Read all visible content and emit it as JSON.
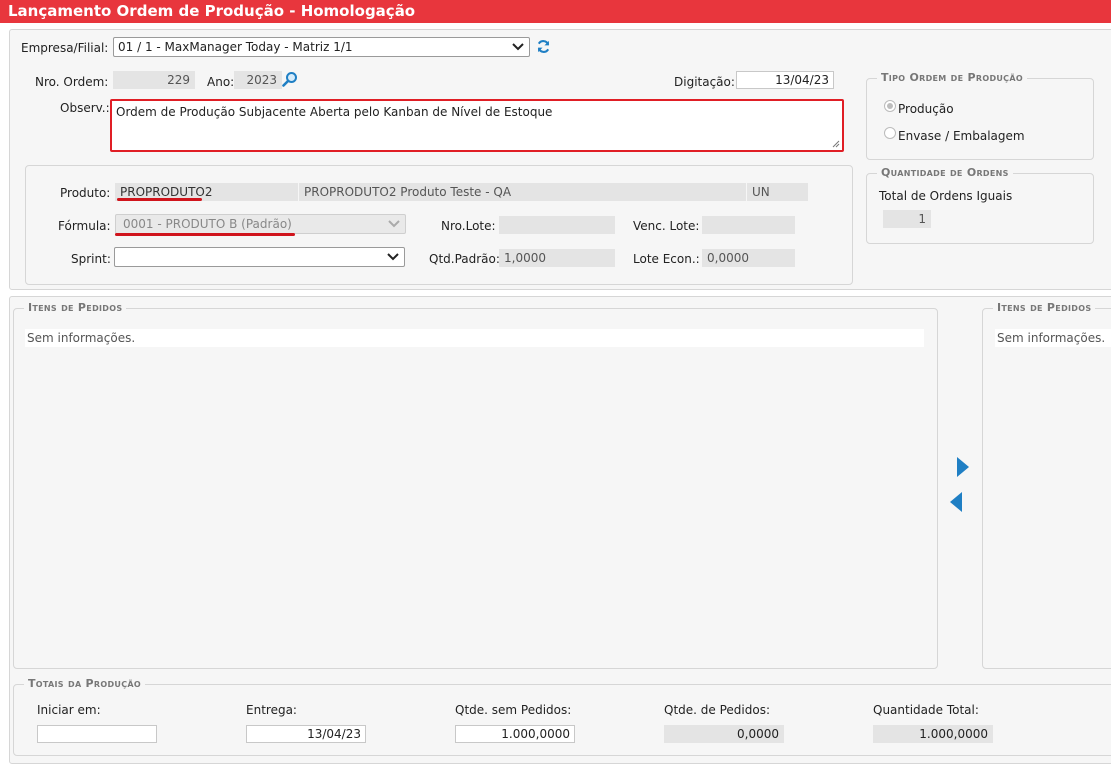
{
  "title": "Lançamento Ordem de Produção  - Homologação",
  "header": {
    "empresa_label": "Empresa/Filial:",
    "empresa_value": "01 / 1 - MaxManager Today - Matriz 1/1",
    "nro_ordem_label": "Nro. Ordem:",
    "nro_ordem_value": "229",
    "ano_label": "Ano:",
    "ano_value": "2023",
    "digitacao_label": "Digitação:",
    "digitacao_value": "13/04/23",
    "observ_label": "Observ.:",
    "observ_value": "Ordem de Produção Subjacente Aberta pelo Kanban de Nível de Estoque"
  },
  "product": {
    "produto_label": "Produto:",
    "produto_code": "PROPRODUTO2",
    "produto_desc": "PROPRODUTO2 Produto Teste - QA",
    "produto_unit": "UN",
    "formula_label": "Fórmula:",
    "formula_value": "0001 - PRODUTO B (Padrão)",
    "nro_lote_label": "Nro.Lote:",
    "nro_lote_value": "",
    "venc_lote_label": "Venc. Lote:",
    "venc_lote_value": "",
    "sprint_label": "Sprint:",
    "sprint_value": "",
    "qtd_padrao_label": "Qtd.Padrão:",
    "qtd_padrao_value": "1,0000",
    "lote_econ_label": "Lote Econ.:",
    "lote_econ_value": "0,0000"
  },
  "tipo_ordem": {
    "legend": "Tipo Ordem de Produção",
    "options": [
      "Produção",
      "Envase / Embalagem"
    ],
    "selected": "Produção"
  },
  "quantidade_ordens": {
    "legend": "Quantidade de Ordens",
    "label": "Total de Ordens Iguais",
    "value": "1"
  },
  "itens_left": {
    "legend": "Itens de Pedidos",
    "empty": "Sem informações."
  },
  "itens_right": {
    "legend": "Itens de Pedidos",
    "empty": "Sem informações."
  },
  "totais": {
    "legend": "Totais da Produção",
    "iniciar_label": "Iniciar em:",
    "iniciar_value": "",
    "entrega_label": "Entrega:",
    "entrega_value": "13/04/23",
    "sem_pedidos_label": "Qtde. sem Pedidos:",
    "sem_pedidos_value": "1.000,0000",
    "de_pedidos_label": "Qtde. de Pedidos:",
    "de_pedidos_value": "0,0000",
    "total_label": "Quantidade Total:",
    "total_value": "1.000,0000"
  },
  "colors": {
    "title_bar": "#e8363d",
    "highlight": "#e01e25",
    "icon_blue": "#1f7fc4"
  }
}
